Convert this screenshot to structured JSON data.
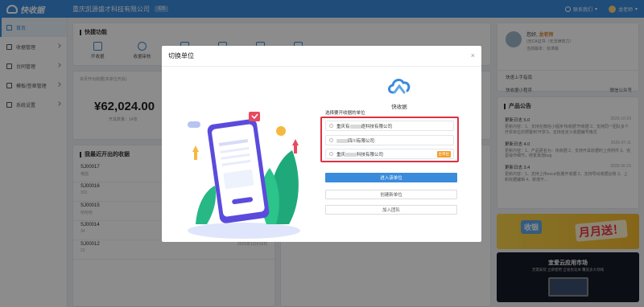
{
  "topbar": {
    "logo_text": "快收据",
    "company": "重庆凯源盛才科技有限公司",
    "company_tag": "ID5",
    "contact": "联系我们",
    "user": "龙老师"
  },
  "sidebar": {
    "items": [
      {
        "label": "首页"
      },
      {
        "label": "收据管理"
      },
      {
        "label": "台同管理"
      },
      {
        "label": "模板/签章管理"
      },
      {
        "label": "系统设置"
      }
    ]
  },
  "quick": {
    "title": "快捷功能",
    "items": [
      {
        "label": "开收据"
      },
      {
        "label": "收据审核"
      },
      {
        "label": ""
      },
      {
        "label": ""
      },
      {
        "label": ""
      },
      {
        "label": ""
      }
    ]
  },
  "stats": {
    "subtitle": "本月开出收据(本单位开具)",
    "amount": "¥62,024.00",
    "count_label": "开具数量：",
    "count": "14张"
  },
  "recent": {
    "title": "我最近开出的收据",
    "items": [
      {
        "no": "SJ00017",
        "sub": "哦豁"
      },
      {
        "no": "SJ00016",
        "sub": "333"
      },
      {
        "no": "SJ00015",
        "sub": "哈哈哈"
      },
      {
        "no": "SJ00014",
        "sub": "34"
      },
      {
        "no": "SJ00012",
        "sub": "23"
      }
    ],
    "last_date": "2025年12月15日"
  },
  "profile": {
    "greeting": "您好,",
    "name": "龙老师",
    "ca": "(无CA证书（无法律效力）",
    "version": "当前版本：标准版",
    "links": [
      "快速上手指南",
      "快收据小程序",
      "微信公众号"
    ]
  },
  "announce": {
    "title": "产品公告",
    "items": [
      {
        "title": "更新日志 5.0",
        "date": "2025-10-29",
        "body": "更新内容：1、支持在微信小程序'快收据'开收据 2、支持同一团队多个开票单位的预警到'开票'3、支持自定义收据编号格式"
      },
      {
        "title": "更新日志 4.0",
        "date": "2025-07-11",
        "body": "更新内容：1、产品更名为：快收据 2、支持开具收据时上传附件 3、完善操作细节，修复其他bug"
      },
      {
        "title": "更新日志 3.4",
        "date": "2025-06-15",
        "body": "更新内容：1、支持上传excel批量开收据 2、支持导出收据台账 3、上新收据编辑 4、新增不..."
      }
    ]
  },
  "banners": {
    "b1_left": "收银",
    "b1_right": "月月送！",
    "b2_title": "宜爱云应用市场",
    "b2_sub": "无需安装 立即使用 全省优化本 覆盖多大领域"
  },
  "modal": {
    "title": "切换单位",
    "close": "×",
    "brand": "快收据",
    "choose_label": "选择要开收据的单位",
    "units": [
      {
        "prefix": "重庆有",
        "suffix": "逐科技有限公司",
        "tag": ""
      },
      {
        "prefix": "",
        "suffix": "四川有限公司",
        "tag": ""
      },
      {
        "prefix": "重庆",
        "suffix": "科技有限公司",
        "tag": "主单位"
      }
    ],
    "enter_button": "进入该单位",
    "create_button": "创建新单位",
    "join_button": "加入团队"
  }
}
